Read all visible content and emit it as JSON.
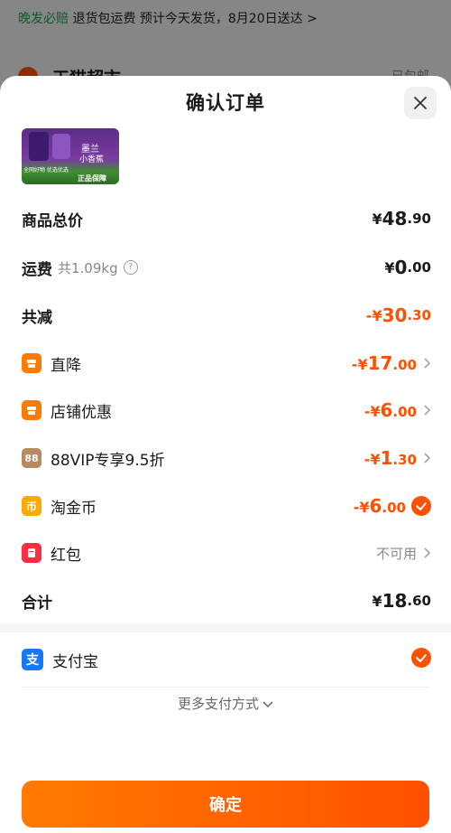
{
  "background": {
    "banner_highlight": "晚发必赔",
    "banner_text": "退货包运费  预计今天发货，8月20日送达 >",
    "store_name": "天猫超市",
    "store_right": "已包邮"
  },
  "sheet": {
    "title": "确认订单",
    "close_icon": "close-icon"
  },
  "product": {
    "thumb_brand": "墨兰",
    "thumb_name": "小香蕉",
    "thumb_badge1": "全网好物 优选优选",
    "thumb_badge2": "正品保障"
  },
  "summary": {
    "goods_total_label": "商品总价",
    "goods_total": {
      "cur": "¥",
      "int": "48",
      "dec": ".90"
    },
    "shipping_label": "运费",
    "shipping_weight": "共1.09kg",
    "shipping": {
      "cur": "¥",
      "int": "0",
      "dec": ".00"
    },
    "reduction_label": "共减",
    "reduction": {
      "cur": "-¥",
      "int": "30",
      "dec": ".30"
    },
    "total_label": "合计",
    "total": {
      "cur": "¥",
      "int": "18",
      "dec": ".60"
    }
  },
  "discounts": [
    {
      "label": "直降",
      "icon": "shop-icon",
      "color": "#ff7a00",
      "cur": "-¥",
      "int": "17",
      "dec": ".00"
    },
    {
      "label": "店铺优惠",
      "icon": "shop-icon",
      "color": "#ff7a00",
      "cur": "-¥",
      "int": "6",
      "dec": ".00"
    },
    {
      "label": "88VIP专享9.5折",
      "icon_text": "88",
      "color": "#b88a5e",
      "cur": "-¥",
      "int": "1",
      "dec": ".30"
    },
    {
      "label": "淘金币",
      "icon_text": "币",
      "color": "#ffaa00",
      "cur": "-¥",
      "int": "6",
      "dec": ".00"
    },
    {
      "label": "红包",
      "icon": "red-packet-icon",
      "color": "#ff2d3f",
      "status": "不可用"
    }
  ],
  "payment": {
    "method": "支付宝",
    "icon_text": "支",
    "more": "更多支付方式"
  },
  "confirm_label": "确定",
  "colors": {
    "accent": "#ff5000",
    "alipay": "#1677ff"
  }
}
